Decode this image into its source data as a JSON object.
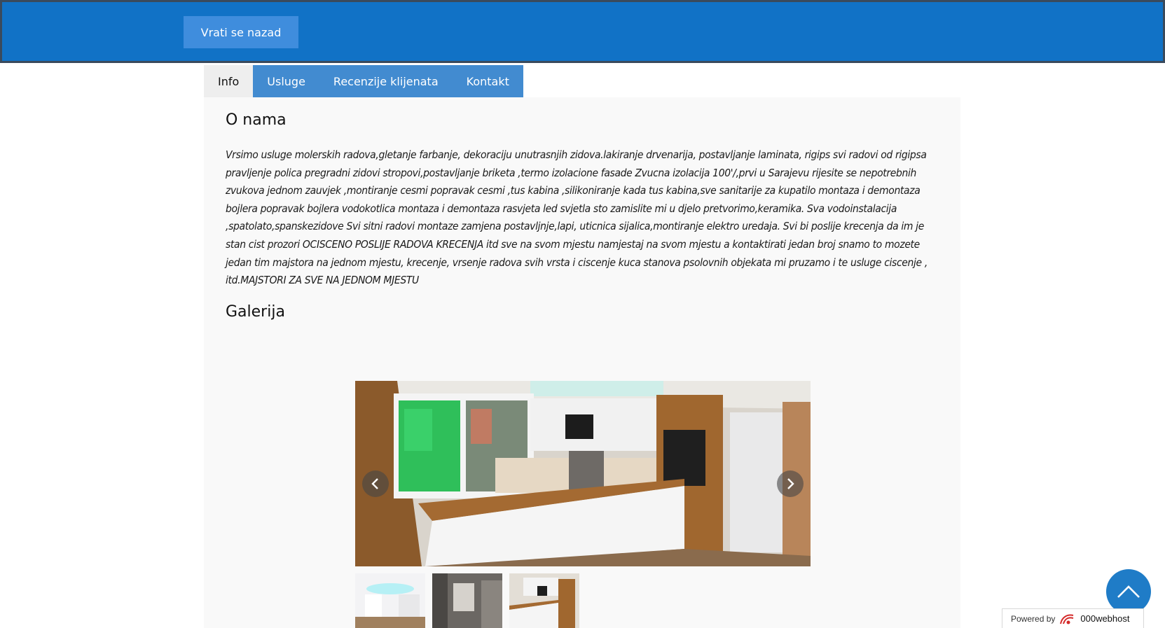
{
  "header": {
    "back_label": "Vrati se nazad"
  },
  "tabs": [
    {
      "label": "Info",
      "active": true
    },
    {
      "label": "Usluge",
      "active": false
    },
    {
      "label": "Recenzije klijenata",
      "active": false
    },
    {
      "label": "Kontakt",
      "active": false
    }
  ],
  "about": {
    "title": "O nama",
    "text": "Vrsimo usluge molerskih radova,gletanje farbanje, dekoraciju unutrasnjih zidova.lakiranje drvenarija, postavljanje laminata, rigips svi radovi od rigipsa pravljenje polica pregradni zidovi stropovi,postavljanje briketa ,termo izolacione fasade Zvucna izolacija 100'/,prvi u Sarajevu rijesite se nepotrebnih zvukova jednom zauvjek ,montiranje cesmi popravak cesmi ,tus kabina ,silikoniranje kada tus kabina,sve sanitarije za kupatilo montaza i demontaza bojlera popravak bojlera vodokotlica montaza i demontaza rasvjeta led svjetla sto zamislite mi u djelo pretvorimo,keramika. Sva vodoinstalacija ,spatolato,spanskezidove Svi sitni radovi montaze zamjena postavljnje,lapi, uticnica sijalica,montiranje elektro uredaja. Svi bi poslije krecenja da im je stan cist prozori OCISCENO POSLIJE RADOVA KRECENJA itd sve na svom mjestu namjestaj na svom mjestu a kontaktirati jedan broj snamo to mozete jedan tim majstora na jednom mjestu, krecenje, vrsenje radova svih vrsta i ciscenje kuca stanova psolovnih objekata mi pruzamo i te usluge ciscenje , itd.MAJSTORI ZA SVE NA JEDNOM MJESTU"
  },
  "gallery": {
    "title": "Galerija",
    "main_image": "kitchen-photo",
    "thumbnails": [
      "hallway-photo",
      "bathroom-renovation-photo",
      "kitchen-photo"
    ]
  },
  "icons": {
    "prev": "chevron-left-icon",
    "next": "chevron-right-icon",
    "scroll_top": "chevron-up-icon"
  },
  "footer": {
    "powered_label": "Powered by",
    "brand": "000webhost"
  },
  "colors": {
    "header": "#1172c6",
    "tab": "#428bd0",
    "scroll_top": "#1f7cc7"
  }
}
